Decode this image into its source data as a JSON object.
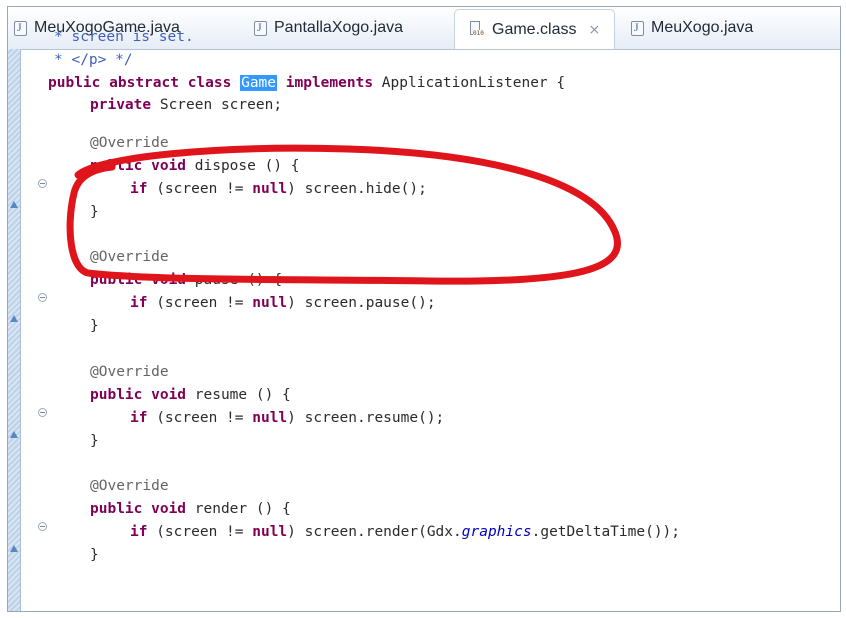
{
  "tabs": [
    {
      "label": "MeuXogoGame.java",
      "type": "java",
      "active": false
    },
    {
      "label": "PantallaXogo.java",
      "type": "java",
      "active": false
    },
    {
      "label": "Game.class",
      "type": "class",
      "active": true,
      "close": "⨯"
    },
    {
      "label": "MeuXogo.java",
      "type": "java",
      "active": false
    }
  ],
  "code": {
    "comment1": "* screen is set.",
    "comment2": "* </p> */",
    "class_kw1": "public",
    "class_kw2": "abstract",
    "class_kw3": "class",
    "class_name": "Game",
    "class_kw4": "implements",
    "class_rest": "ApplicationListener {",
    "field_kw": "private",
    "field_rest": "Screen screen;",
    "annotation": "@Override",
    "public_void": "public void",
    "if_open": "if",
    "null_kw": "null",
    "close_brace": "}",
    "methods": [
      {
        "name": " dispose () {",
        "call_pre": "(screen != ",
        "call_post": ") screen.hide();"
      },
      {
        "name": " pause () {",
        "call_pre": "(screen != ",
        "call_post": ") screen.pause();"
      },
      {
        "name": " resume () {",
        "call_pre": "(screen != ",
        "call_post": ") screen.resume();"
      },
      {
        "name": " render () {",
        "call_pre": "(screen != ",
        "call_post_a": ") screen.render(Gdx.",
        "call_italic": "graphics",
        "call_post_b": ".getDeltaTime());"
      }
    ]
  },
  "colors": {
    "keyword": "#7f0055",
    "comment": "#3f5fbf",
    "annotation": "#646464",
    "selection": "#3399ff",
    "highlight_circle": "#e0141b"
  }
}
